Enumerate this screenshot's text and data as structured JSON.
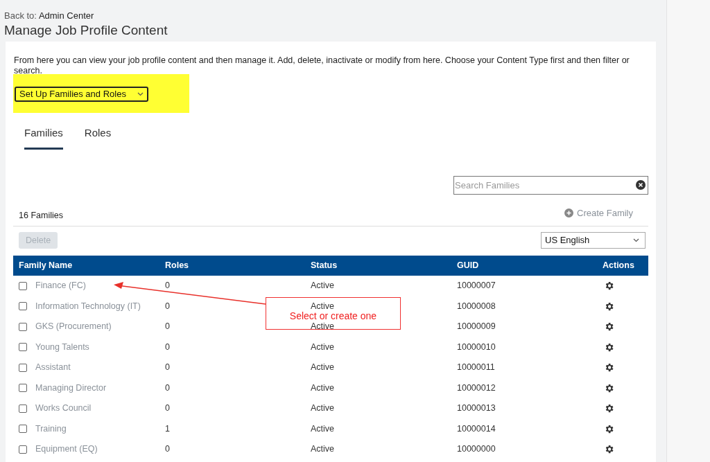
{
  "header": {
    "back_label": "Back to:",
    "back_link": "Admin Center",
    "title": "Manage Job Profile Content"
  },
  "intro": "From here you can view your job profile content and then manage it. Add, delete, inactivate or modify from here. Choose your Content Type first and then filter or search.",
  "content_type": {
    "value": "Set Up Families and Roles",
    "highlighted": true
  },
  "tabs": [
    {
      "label": "Families",
      "selected": true
    },
    {
      "label": "Roles",
      "selected": false
    }
  ],
  "search": {
    "placeholder": "Search Families"
  },
  "count": "16 Families",
  "create_button": "Create Family",
  "delete_button": {
    "label": "Delete",
    "disabled": true
  },
  "language": "US English",
  "table": {
    "columns": [
      "Family Name",
      "Roles",
      "Status",
      "GUID",
      "Actions"
    ],
    "rows": [
      {
        "name": "Finance (FC)",
        "roles": "0",
        "status": "Active",
        "guid": "10000007",
        "checked": false
      },
      {
        "name": "Information Technology (IT)",
        "roles": "0",
        "status": "Active",
        "guid": "10000008",
        "checked": false
      },
      {
        "name": "GKS (Procurement)",
        "roles": "0",
        "status": "Active",
        "guid": "10000009",
        "checked": false
      },
      {
        "name": "Young Talents",
        "roles": "0",
        "status": "Active",
        "guid": "10000010",
        "checked": false
      },
      {
        "name": "Assistant",
        "roles": "0",
        "status": "Active",
        "guid": "10000011",
        "checked": false
      },
      {
        "name": "Managing Director",
        "roles": "0",
        "status": "Active",
        "guid": "10000012",
        "checked": false
      },
      {
        "name": "Works Council",
        "roles": "0",
        "status": "Active",
        "guid": "10000013",
        "checked": false
      },
      {
        "name": "Training",
        "roles": "1",
        "status": "Active",
        "guid": "10000014",
        "checked": false
      },
      {
        "name": "Equipment (EQ)",
        "roles": "0",
        "status": "Active",
        "guid": "10000000",
        "checked": false
      }
    ]
  },
  "annotation": {
    "text": "Select or create one"
  }
}
